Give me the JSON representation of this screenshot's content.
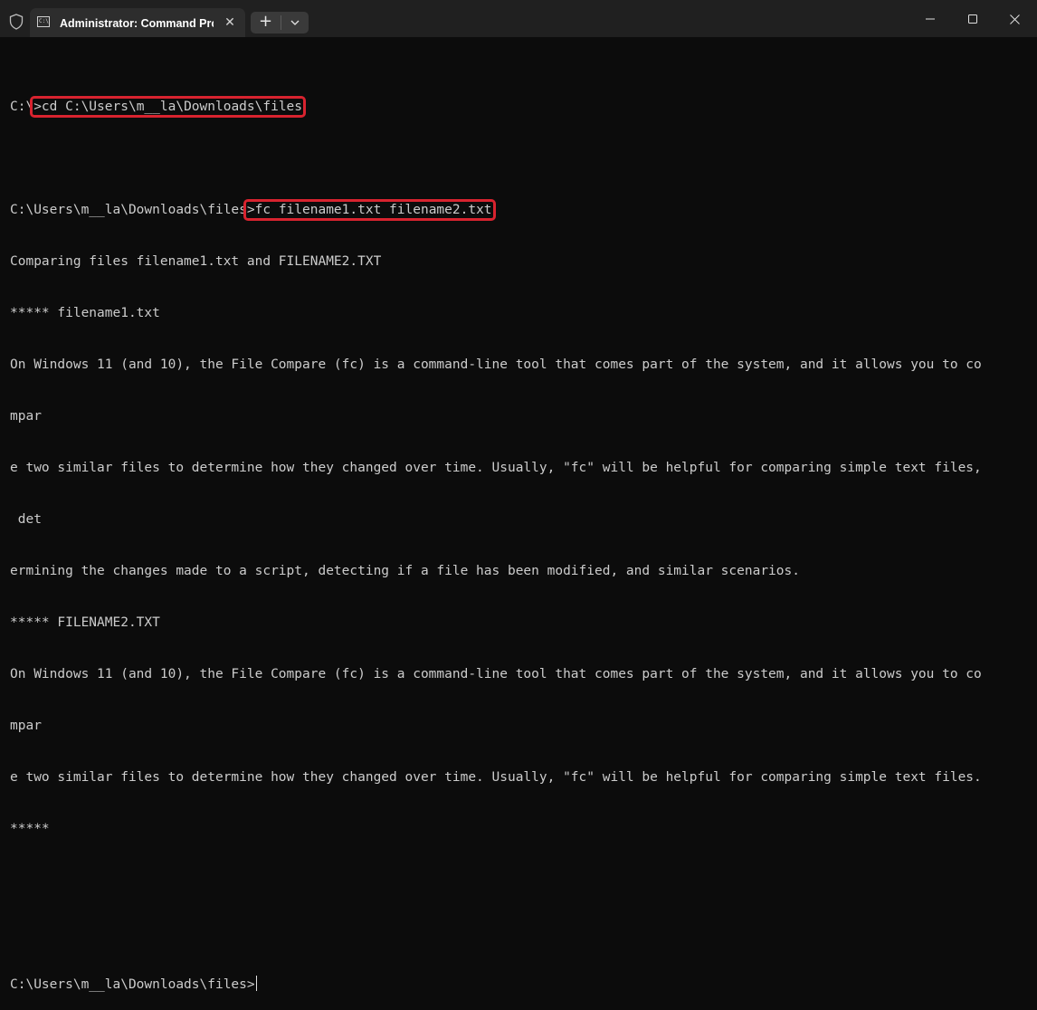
{
  "window": {
    "tab_title": "Administrator: Command Pro",
    "tab_icon_text": "C:\\",
    "new_tab_symbol": "+",
    "tab_close_symbol": "✕",
    "icons": {
      "admin": "shield-icon",
      "tab": "command-prompt-icon",
      "dropdown": "chevron-down-icon",
      "minimize": "minimize-icon",
      "maximize": "maximize-icon",
      "close": "close-icon"
    }
  },
  "colors": {
    "background": "#0c0c0c",
    "titlebar": "#202020",
    "text": "#cccccc",
    "highlight": "#d8232f"
  },
  "terminal": {
    "line1": {
      "prompt": "C:\\",
      "command": ">cd C:\\Users\\m__la\\Downloads\\files"
    },
    "line2": {
      "prompt": "C:\\Users\\m__la\\Downloads\\files",
      "command": ">fc filename1.txt filename2.txt"
    },
    "output": [
      "Comparing files filename1.txt and FILENAME2.TXT",
      "***** filename1.txt",
      "On Windows 11 (and 10), the File Compare (fc) is a command-line tool that comes part of the system, and it allows you to co",
      "mpar",
      "e two similar files to determine how they changed over time. Usually, \"fc\" will be helpful for comparing simple text files,",
      " det",
      "ermining the changes made to a script, detecting if a file has been modified, and similar scenarios.",
      "***** FILENAME2.TXT",
      "On Windows 11 (and 10), the File Compare (fc) is a command-line tool that comes part of the system, and it allows you to co",
      "mpar",
      "e two similar files to determine how they changed over time. Usually, \"fc\" will be helpful for comparing simple text files.",
      "*****"
    ],
    "final_prompt": "C:\\Users\\m__la\\Downloads\\files>"
  }
}
